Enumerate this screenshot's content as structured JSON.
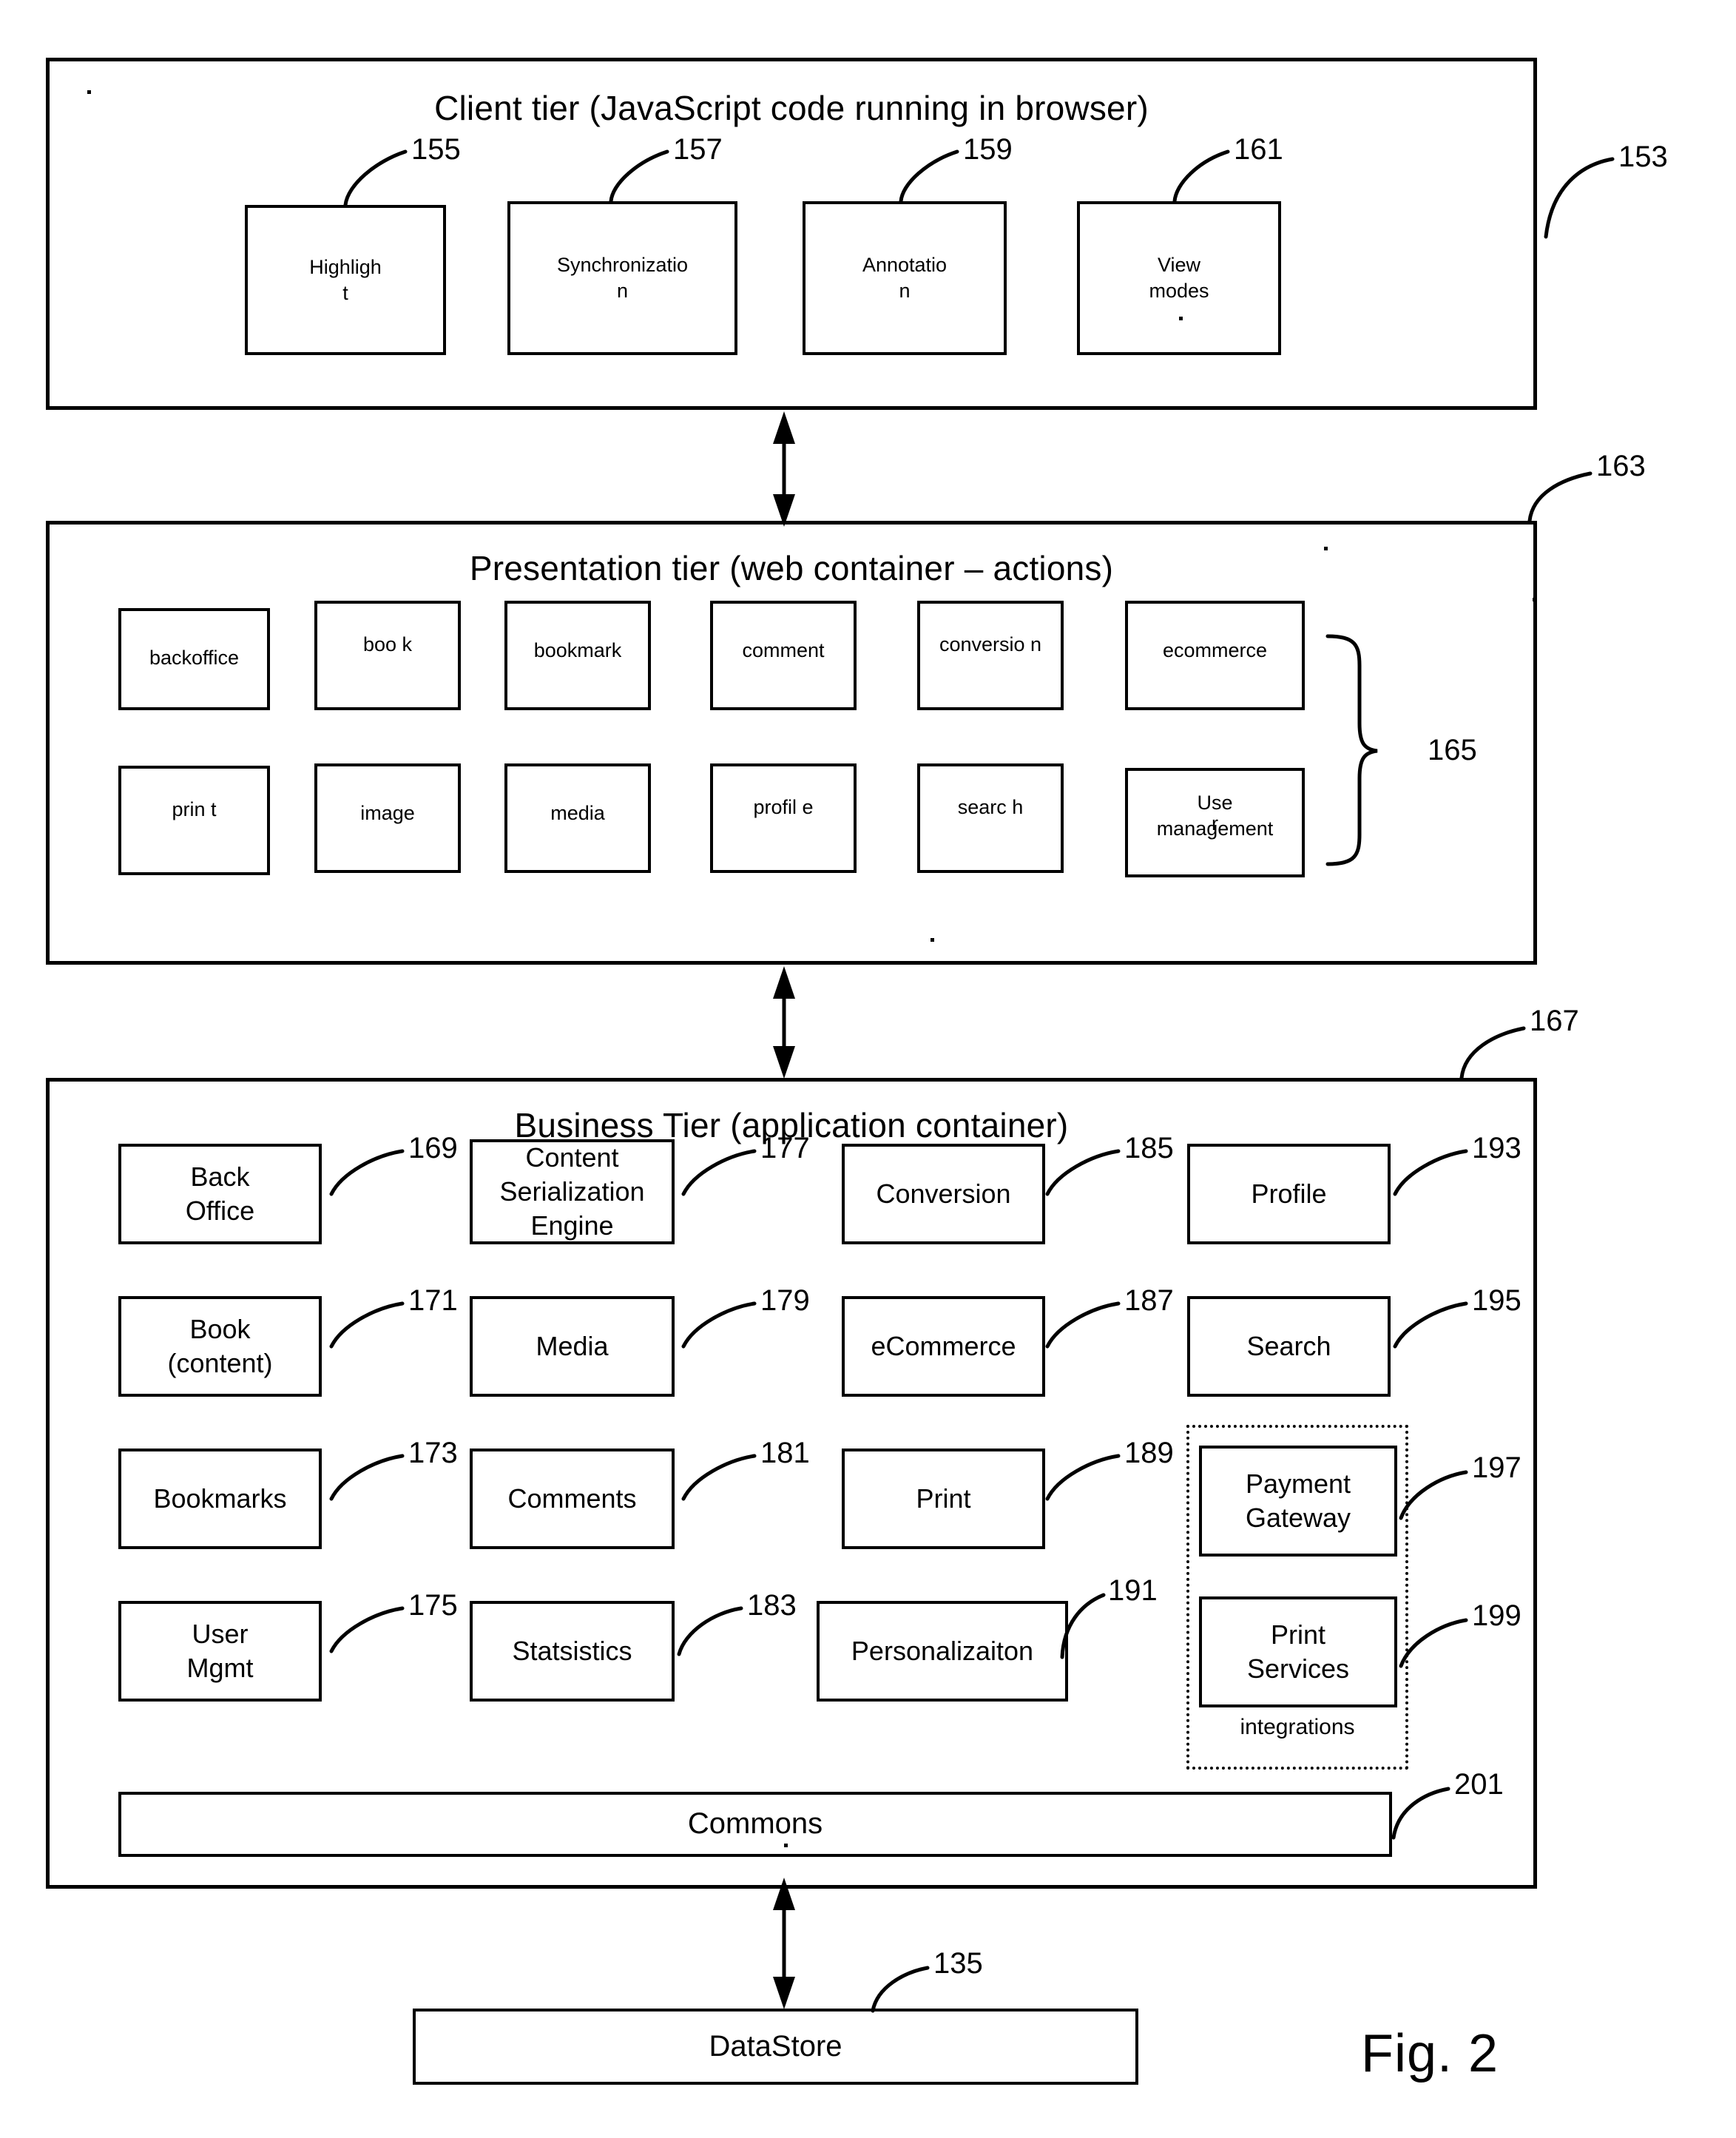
{
  "figure": {
    "caption": "Fig. 2"
  },
  "client_tier": {
    "title": "Client tier (JavaScript code running in browser)",
    "ref": "153",
    "boxes": [
      {
        "label_line1": "Highligh",
        "label_line2": "t",
        "ref": "155"
      },
      {
        "label_line1": "Synchronizatio",
        "label_line2": "n",
        "ref": "157"
      },
      {
        "label_line1": "Annotatio",
        "label_line2": "n",
        "ref": "159"
      },
      {
        "label_line1": "View",
        "label_line2": "modes",
        "ref": "161"
      }
    ]
  },
  "presentation_tier": {
    "title": "Presentation tier (web container – actions)",
    "ref": "163",
    "group_ref": "165",
    "row1": [
      {
        "label_line1": "backoffice",
        "label_line2": ""
      },
      {
        "label_line1": "boo",
        "label_line2": "k"
      },
      {
        "label_line1": "bookmark",
        "label_line2": ""
      },
      {
        "label_line1": "comment",
        "label_line2": ""
      },
      {
        "label_line1": "conversio",
        "label_line2": "n"
      },
      {
        "label_line1": "ecommerce",
        "label_line2": ""
      }
    ],
    "row2": [
      {
        "label_line1": "prin",
        "label_line2": "t"
      },
      {
        "label_line1": "image",
        "label_line2": ""
      },
      {
        "label_line1": "media",
        "label_line2": ""
      },
      {
        "label_line1": "profil",
        "label_line2": "e"
      },
      {
        "label_line1": "searc",
        "label_line2": "h"
      },
      {
        "label_line1": "Use",
        "label_line2": "management",
        "overlap": "r"
      }
    ]
  },
  "business_tier": {
    "title": "Business Tier (application container)",
    "ref": "167",
    "column1": [
      {
        "label_line1": "Back",
        "label_line2": "Office",
        "ref": "169"
      },
      {
        "label_line1": "Book",
        "label_line2": "(content)",
        "ref": "171"
      },
      {
        "label_line1": "Bookmarks",
        "label_line2": "",
        "ref": "173"
      },
      {
        "label_line1": "User",
        "label_line2": "Mgmt",
        "ref": "175"
      }
    ],
    "column2": [
      {
        "label_line1": "Content",
        "label_line2": "Serialization",
        "label_line3": "Engine",
        "ref": "177"
      },
      {
        "label_line1": "Media",
        "label_line2": "",
        "ref": "179"
      },
      {
        "label_line1": "Comments",
        "label_line2": "",
        "ref": "181"
      },
      {
        "label_line1": "Statsistics",
        "label_line2": "",
        "ref": "183"
      }
    ],
    "column3": [
      {
        "label_line1": "Conversion",
        "label_line2": "",
        "ref": "185"
      },
      {
        "label_line1": "eCommerce",
        "label_line2": "",
        "ref": "187"
      },
      {
        "label_line1": "Print",
        "label_line2": "",
        "ref": "189"
      },
      {
        "label_line1": "Personalizaiton",
        "label_line2": "",
        "ref": "191"
      }
    ],
    "column4": [
      {
        "label_line1": "Profile",
        "label_line2": "",
        "ref": "193"
      },
      {
        "label_line1": "Search",
        "label_line2": "",
        "ref": "195"
      }
    ],
    "integrations": {
      "label": "integrations",
      "boxes": [
        {
          "label_line1": "Payment",
          "label_line2": "Gateway",
          "ref": "197"
        },
        {
          "label_line1": "Print",
          "label_line2": "Services",
          "ref": "199"
        }
      ]
    },
    "commons": {
      "label": "Commons",
      "ref": "201"
    }
  },
  "datastore": {
    "label": "DataStore",
    "ref": "135"
  }
}
